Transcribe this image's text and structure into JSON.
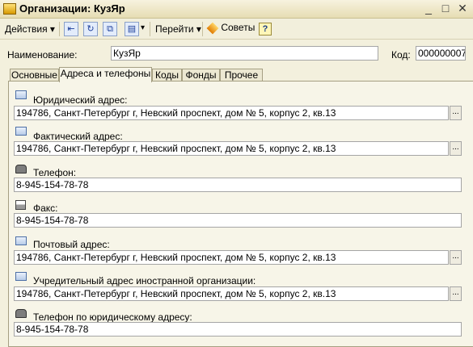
{
  "window": {
    "title": "Организации: КузЯр",
    "minimize": "_",
    "maximize": "□",
    "close": "✕"
  },
  "toolbar": {
    "actions_label": "Действия",
    "goto_label": "Перейти",
    "tips_label": "Советы",
    "help_label": "?"
  },
  "form": {
    "name_label": "Наименование:",
    "name_value": "КузЯр",
    "code_label": "Код:",
    "code_value": "000000007"
  },
  "tabs": [
    "Основные",
    "Адреса и телефоны",
    "Коды",
    "Фонды",
    "Прочее"
  ],
  "active_tab": "Адреса и телефоны",
  "fields": [
    {
      "label": "Юридический адрес:",
      "value": "194786, Санкт-Петербург г, Невский проспект, дом № 5, корпус 2, кв.13"
    },
    {
      "label": "Фактический адрес:",
      "value": "194786, Санкт-Петербург г, Невский проспект, дом № 5, корпус 2, кв.13"
    },
    {
      "label": "Телефон:",
      "value": "8-945-154-78-78"
    },
    {
      "label": "Факс:",
      "value": "8-945-154-78-78"
    },
    {
      "label": "Почтовый адрес:",
      "value": "194786, Санкт-Петербург г, Невский проспект, дом № 5, корпус 2, кв.13"
    },
    {
      "label": "Учредительный адрес иностранной организации:",
      "value": "194786, Санкт-Петербург г, Невский проспект, дом № 5, корпус 2, кв.13"
    },
    {
      "label": "Телефон по юридическому адресу:",
      "value": "8-945-154-78-78"
    }
  ],
  "select_button_label": "...",
  "colors": {
    "window_bg": "#f3f0dd",
    "panel_bg": "#f7f5e8",
    "border": "#a5a5a5"
  }
}
